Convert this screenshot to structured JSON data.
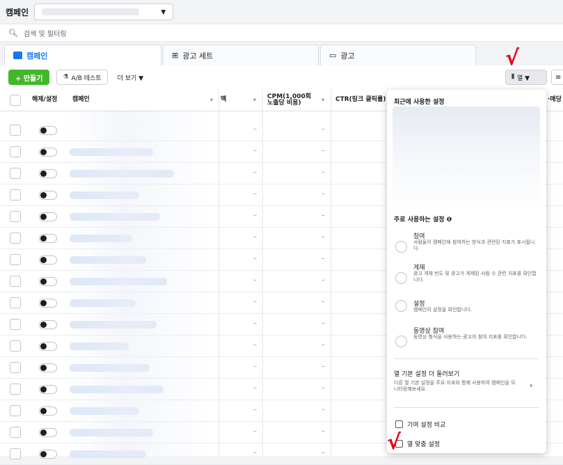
{
  "topbar": {
    "title": "캠페인",
    "caret": "▼"
  },
  "search": {
    "placeholder": "검색 및 필터링",
    "icon": "search-icon"
  },
  "tabs": [
    {
      "label": "캠페인",
      "icon": "folder-icon",
      "active": true
    },
    {
      "label": "광고 세트",
      "icon": "grid-icon",
      "active": false
    },
    {
      "label": "광고",
      "icon": "ad-icon",
      "active": false
    }
  ],
  "toolbar": {
    "create_label": "+ 만들기",
    "ab_label": "A/B 테스트",
    "more_label": "더 보기 ▼",
    "columns_label": "열 ▼",
    "sort_label": "≡"
  },
  "table": {
    "headers": {
      "toggle": "해제/설정",
      "campaign": "캠페인",
      "col_amount": "액",
      "cpm": "CPM(1,000회 노출당 비용)",
      "ctr": "CTR(링크 클릭률)",
      "last": "·매당"
    },
    "dash": "–",
    "row_count": 16
  },
  "panel": {
    "recent_title": "최근에 사용한 설정",
    "frequent_title": "주로 사용하는 설정",
    "info_icon": "info-icon",
    "options": [
      {
        "title": "참여",
        "desc": "사람들이 캠페인에 참여하는 방식과 관련된 지표가 표시됩니다."
      },
      {
        "title": "게재",
        "desc": "광고 게재 빈도 및 광고가 게재된 사람 수 관련 지표를 확인합니다."
      },
      {
        "title": "설정",
        "desc": "캠페인의 설정을 확인합니다."
      },
      {
        "title": "동영상 참여",
        "desc": "동영상 형식을 사용하는 광고의 참여 지표를 확인합니다."
      }
    ],
    "more_title": "열 기본 설정 더 둘러보기",
    "more_desc": "다른 열 기본 설정을 주요 지표와 함께 사용하여 캠페인을 모니터링해보세요.",
    "compare_label": "기여 설정 비교",
    "customize_label": "열 맞춤 설정"
  },
  "colors": {
    "accent": "#1877f2",
    "create": "#42b72a",
    "annotation": "#e0001b"
  }
}
